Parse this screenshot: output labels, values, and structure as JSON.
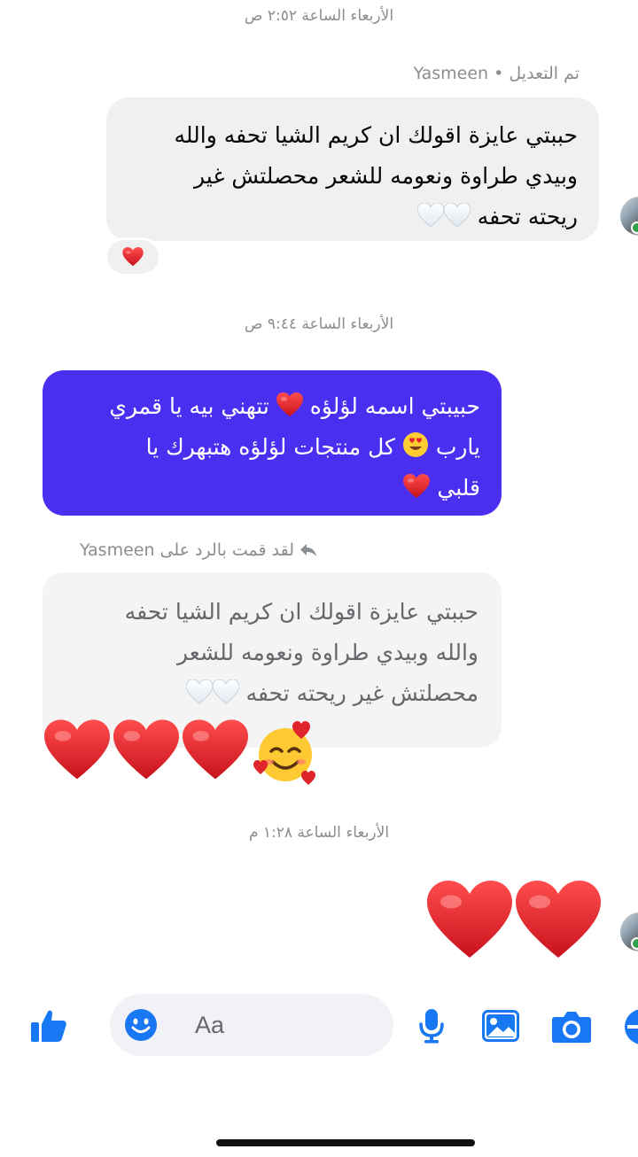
{
  "timestamps": [
    "الأربعاء الساعة ٢:٥٢ ص",
    "الأربعاء الساعة ٩:٤٤ ص",
    "الأربعاء الساعة ١:٢٨ م"
  ],
  "incoming": {
    "sender": "Yasmeen",
    "edited": "• تم التعديل",
    "lines": [
      "حببتي عايزة اقولك ان كريم الشيا تحفه والله",
      "وبيدي طراوة ونعومه للشعر محصلتش غير",
      "ريحته تحفه"
    ],
    "reaction": "red-heart"
  },
  "outgoing": {
    "lines": [
      "حبيبتي اسمه لؤلؤه",
      "تتهني بيه يا قمري",
      "يارب",
      "كل منتجات لؤلؤه هتبهرك يا",
      "قلبي"
    ]
  },
  "reply": {
    "label": "لقد قمت بالرد على",
    "target": "Yasmeen",
    "quoted_lines": [
      "حببتي عايزة اقولك ان كريم الشيا تحفه",
      "والله وبيدي طراوة ونعومه للشعر",
      "محصلتش غير ريحته تحفه"
    ]
  },
  "composer": {
    "placeholder": "Aa",
    "icons": [
      "like-icon",
      "emoji-icon",
      "microphone-icon",
      "gallery-icon",
      "camera-icon",
      "plus-icon"
    ]
  },
  "colors": {
    "accent": "#1877f2",
    "outgoing_bubble": "#4b2ff0",
    "heart": "#e0242b"
  }
}
